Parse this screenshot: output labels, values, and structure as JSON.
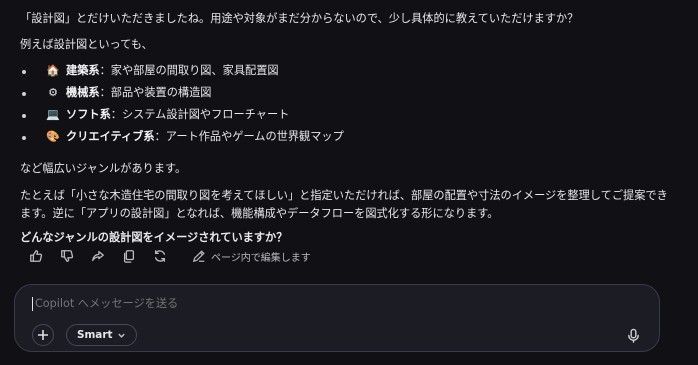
{
  "message": {
    "intro": "「設計図」とだけいただきましたね。用途や対象がまだ分からないので、少し具体的に教えていただけますか？",
    "examples_lead": "例えば設計図といっても、",
    "items": [
      {
        "icon": "house-icon",
        "glyph": "🏠",
        "term": "建築系",
        "desc": "：家や部屋の間取り図、家具配置図"
      },
      {
        "icon": "gear-icon",
        "glyph": "⚙",
        "term": "機械系",
        "desc": "：部品や装置の構造図"
      },
      {
        "icon": "laptop-icon",
        "glyph": "💻",
        "term": "ソフト系",
        "desc": "：システム設計図やフローチャート"
      },
      {
        "icon": "palette-icon",
        "glyph": "🎨",
        "term": "クリエイティブ系",
        "desc": "：アート作品やゲームの世界観マップ"
      }
    ],
    "variety": "など幅広いジャンルがあります。",
    "example_detail": "たとえば「小さな木造住宅の間取り図を考えてほしい」と指定いただければ、部屋の配置や寸法のイメージを整理してご提案できます。逆に「アプリの設計図」となれば、機能構成やデータフローを図式化する形になります。",
    "question": "どんなジャンルの設計図をイメージされていますか？"
  },
  "actions": {
    "edit_label": "ページ内で編集します"
  },
  "composer": {
    "placeholder": "Copilot へメッセージを送る",
    "mode_label": "Smart"
  }
}
